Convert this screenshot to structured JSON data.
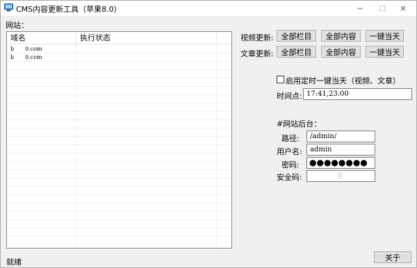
{
  "window": {
    "title": "CMS内容更新工具（苹果8.0）",
    "controls": {
      "minimize": "─",
      "maximize": "☐",
      "close": "✕"
    }
  },
  "sites": {
    "label": "网站：",
    "columns": [
      "域名",
      "执行状态"
    ],
    "rows": [
      {
        "domain": "b　　0.com",
        "status": ""
      },
      {
        "domain": "b　　0.com",
        "status": ""
      }
    ]
  },
  "video_update": {
    "label": "视频更新:",
    "all_columns": "全部栏目",
    "all_content": "全部内容",
    "one_click_today": "一键当天"
  },
  "article_update": {
    "label": "文章更新:",
    "all_columns": "全部栏目",
    "all_content": "全部内容",
    "one_click_today": "一键当天"
  },
  "schedule": {
    "enable_label": "启用定时一键当天（视频、文章）",
    "checked": false,
    "time_label": "时间点:",
    "time_value": "17:41,23:00"
  },
  "backend": {
    "section_label": "#网站后台：",
    "path_label": "路径:",
    "path_value": "/admin/",
    "username_label": "用户名:",
    "username_value": "admin",
    "password_label": "密码:",
    "password_value": "●●●●●●●●",
    "security_code_label": "安全码:",
    "security_code_value": "　　　　1"
  },
  "footer": {
    "status": "就绪",
    "about_button": "关于"
  }
}
